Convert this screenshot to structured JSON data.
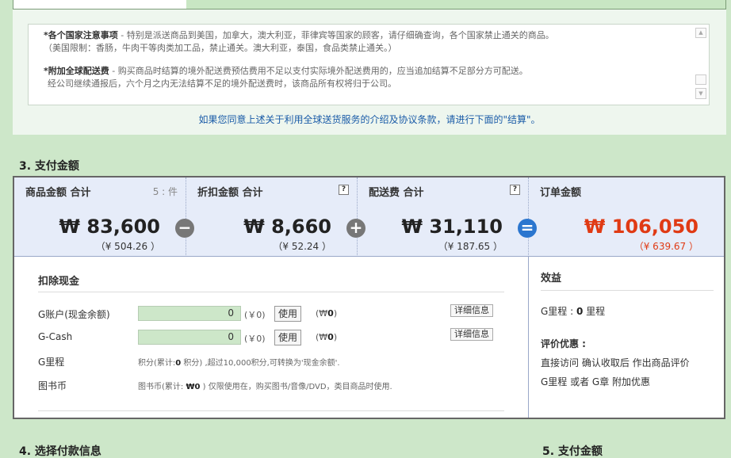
{
  "notice": {
    "p1_title": "*各个国家注意事项",
    "p1_line1": " - 特别是派送商品到美国，加拿大，澳大利亚，菲律宾等国家的顾客，请仔细确查询，各个国家禁止通关的商品。",
    "p1_line2": "（美国限制：香肠，牛肉干等肉类加工品，禁止通关。澳大利亚，泰国，食品类禁止通关。）",
    "p2_title": "*附加全球配送费",
    "p2_line1": " - 购买商品时结算的境外配送费预估费用不足以支付实际境外配送费用的，应当追加结算不足部分方可配送。",
    "p2_line2": "经公司继续通报后，六个月之内无法结算不足的境外配送费时，该商品所有权将归于公司。",
    "agree_text": "如果您同意上述关于利用全球送货服务的介绍及协议条款，请进行下面的\"结算\"。"
  },
  "section3_title": "3. 支付金额",
  "section4_title": "4. 选择付款信息",
  "section5_title": "5. 支付金额",
  "summary": {
    "goods": {
      "label": "商品金额 合计",
      "count": "5 : 件",
      "amount": "₩ 83,600",
      "cny": "（¥ 504.26 ）"
    },
    "discount": {
      "label": "折扣金额 合计",
      "help": "?",
      "amount": "₩ 8,660",
      "cny": "（¥ 52.24 ）"
    },
    "shipping": {
      "label": "配送费 合计",
      "help": "?",
      "amount": "₩ 31,110",
      "cny": "（¥ 187.65 ）"
    },
    "order": {
      "label": "订单金额",
      "amount": "₩ 106,050",
      "cny": "（¥ 639.67 ）"
    },
    "op_minus": "−",
    "op_plus": "+",
    "op_equal": "="
  },
  "deduct": {
    "title": "扣除现金",
    "g_account": {
      "label": "G账户(现金余额)",
      "value": "0",
      "unit": "(￥0)",
      "button": "使用",
      "balance_prefix": "(₩",
      "balance": "0",
      "balance_suffix": ")"
    },
    "g_cash": {
      "label": "G-Cash",
      "value": "0",
      "unit": "(￥0)",
      "button": "使用",
      "balance_prefix": "(₩",
      "balance": "0",
      "balance_suffix": ")"
    },
    "detail_button": "详细信息",
    "g_mileage": {
      "label": "G里程",
      "note_prefix": "积分(累计:",
      "note_value": "0",
      "note_suffix": " 积分) ,超过10,000积分,可转换为'现金余额'."
    },
    "book_coin": {
      "label": "图书币",
      "note_prefix": "图书币(累计: ",
      "note_value": "₩0",
      "note_suffix": " ) 仅限使用在，购买图书/音像/DVD，类目商品时使用."
    }
  },
  "benefits": {
    "title": "效益",
    "mileage_prefix": "G里程 : ",
    "mileage_value": "0",
    "mileage_suffix": " 里程",
    "review_title": "评价优惠 :",
    "review_line1": "直接访问 确认收取后 作出商品评价",
    "review_line2": "G里程 或者 G章 附加优惠"
  }
}
